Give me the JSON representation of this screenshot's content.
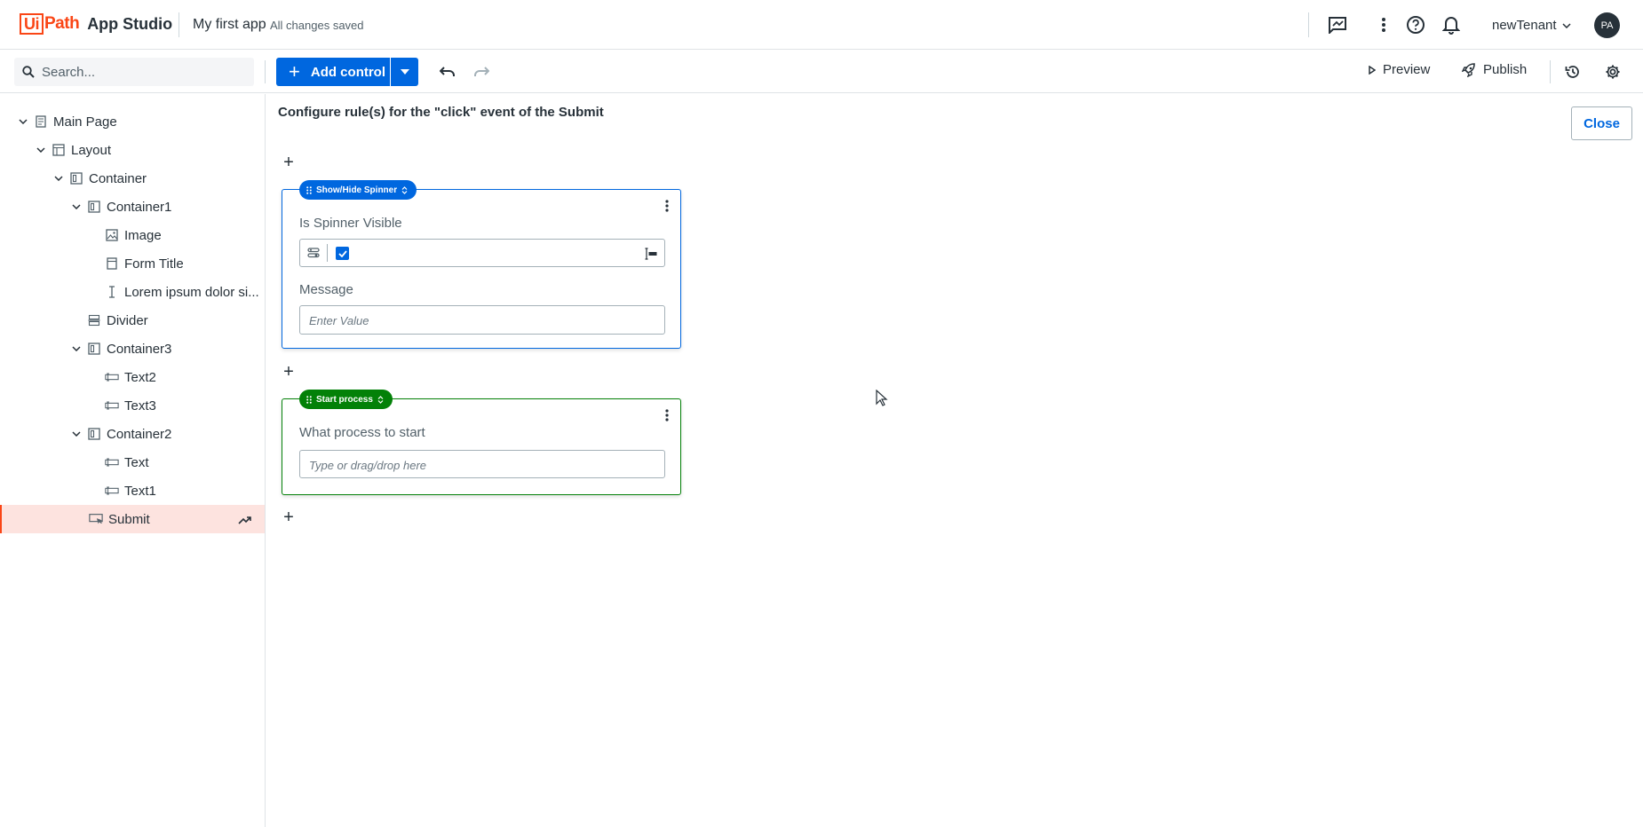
{
  "header": {
    "logo_ui": "Ui",
    "logo_path": "Path",
    "logo_product": "App Studio",
    "app_name": "My first app",
    "save_status": "All changes saved",
    "tenant": "newTenant",
    "avatar_initials": "PA"
  },
  "toolbar": {
    "search_placeholder": "Search...",
    "add_control_label": "Add control",
    "preview_label": "Preview",
    "publish_label": "Publish"
  },
  "tree": {
    "items": [
      {
        "label": "Main Page",
        "icon": "page-icon"
      },
      {
        "label": "Layout",
        "icon": "layout-icon"
      },
      {
        "label": "Container",
        "icon": "container-icon"
      },
      {
        "label": "Container1",
        "icon": "container-icon"
      },
      {
        "label": "Image",
        "icon": "image-icon"
      },
      {
        "label": "Form Title",
        "icon": "header-icon"
      },
      {
        "label": "Lorem ipsum dolor si...",
        "icon": "text-cursor-icon"
      },
      {
        "label": "Divider",
        "icon": "divider-icon"
      },
      {
        "label": "Container3",
        "icon": "container-icon"
      },
      {
        "label": "Text2",
        "icon": "textbox-icon"
      },
      {
        "label": "Text3",
        "icon": "textbox-icon"
      },
      {
        "label": "Container2",
        "icon": "container-icon"
      },
      {
        "label": "Text",
        "icon": "textbox-icon"
      },
      {
        "label": "Text1",
        "icon": "textbox-icon"
      },
      {
        "label": "Submit",
        "icon": "button-icon",
        "selected": true
      }
    ]
  },
  "main": {
    "title": "Configure rule(s) for the \"click\" event of the Submit",
    "close_label": "Close",
    "add_rule_symbol": "+",
    "rules": [
      {
        "name": "Show/Hide Spinner",
        "color": "#0067df",
        "fields": [
          {
            "label": "Is Spinner Visible",
            "checked": true
          },
          {
            "label": "Message",
            "placeholder": "Enter Value"
          }
        ]
      },
      {
        "name": "Start process",
        "color": "#038108",
        "fields": [
          {
            "label": "What process to start",
            "placeholder": "Type or drag/drop here"
          }
        ]
      }
    ]
  },
  "colors": {
    "brand_orange": "#fa4616",
    "primary_blue": "#0067df",
    "success_green": "#038108",
    "selected_bg": "#fde3df"
  }
}
